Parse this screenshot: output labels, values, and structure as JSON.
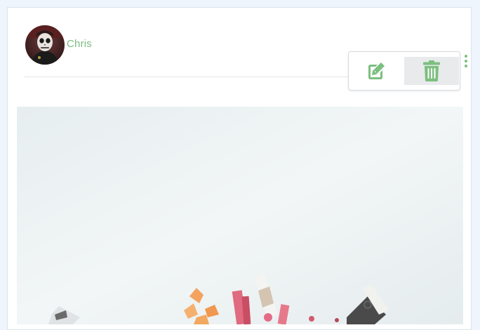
{
  "post": {
    "author": {
      "name": "Chris",
      "avatar_icon": "avatar-skull-makeup"
    },
    "menu": {
      "more_icon": "vertical-ellipsis-icon",
      "items": [
        {
          "action": "edit",
          "icon": "edit-icon"
        },
        {
          "action": "delete",
          "icon": "trash-icon"
        }
      ]
    },
    "image_alt": "food-flatlay-photo"
  },
  "colors": {
    "accent": "#7cbf7f",
    "background": "#eef5fc",
    "card": "#ffffff",
    "hover": "#e8eaec"
  }
}
